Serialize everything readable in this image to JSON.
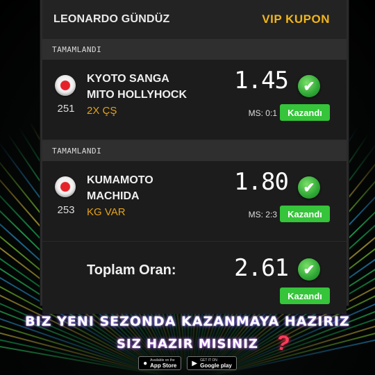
{
  "header": {
    "name": "LEONARDO GÜNDÜZ",
    "badge": "VIP KUPON"
  },
  "colors": {
    "accent_gold": "#f2b51a",
    "won_green": "#35c43a",
    "bet_orange": "#e3a21c"
  },
  "matches": [
    {
      "status": "TAMAMLANDI",
      "flag_icon": "japan-flag-icon",
      "code": "251",
      "home": "KYOTO SANGA",
      "away": "MITO HOLLYHOCK",
      "bet": "2X ÇŞ",
      "odd": "1.45",
      "score": "MS: 0:1",
      "result": "Kazandı"
    },
    {
      "status": "TAMAMLANDI",
      "flag_icon": "japan-flag-icon",
      "code": "253",
      "home": "KUMAMOTO",
      "away": "MACHIDA",
      "bet": "KG VAR",
      "odd": "1.80",
      "score": "MS: 2:3",
      "result": "Kazandı"
    }
  ],
  "total": {
    "label": "Toplam Oran:",
    "odd": "2.61",
    "result": "Kazandı"
  },
  "footer": {
    "headline": "BIZ YENI SEZONDA KAZANMAYA HAZIRIZ",
    "subline": "SIZ HAZIR MISINIZ",
    "question_mark": "?",
    "app_store_small": "Available on the",
    "app_store_big": "App Store",
    "google_play_small": "GET IT ON",
    "google_play_big": "Google play"
  }
}
